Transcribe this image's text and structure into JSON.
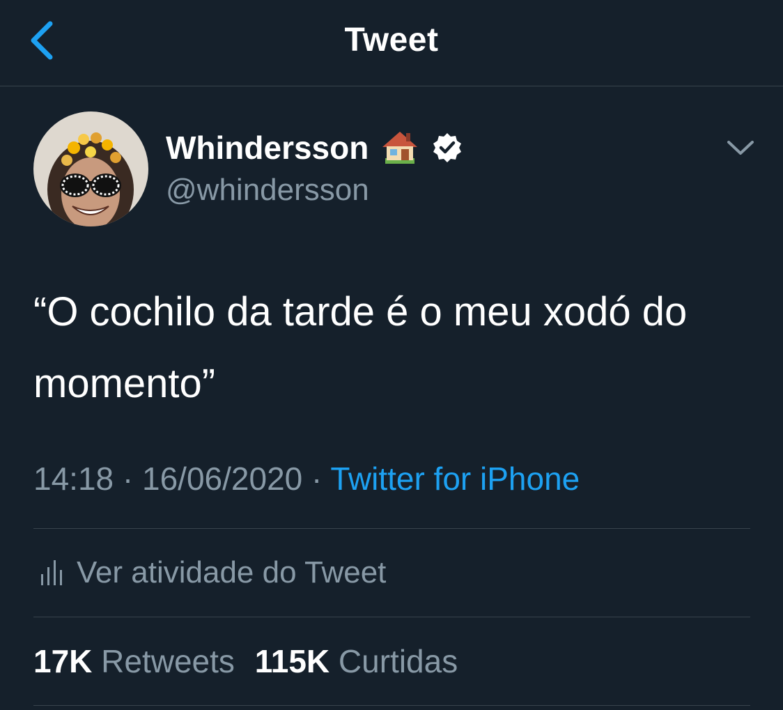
{
  "header": {
    "title": "Tweet",
    "back_icon": "chevron-left-icon"
  },
  "author": {
    "name": "Whindersson",
    "handle": "@whindersson",
    "name_emoji": "house-icon",
    "verified_icon": "verified-badge-icon"
  },
  "tweet": {
    "text": "“O cochilo da tarde é o meu xodó do momento”",
    "time": "14:18",
    "separator": "·",
    "date": "16/06/2020",
    "source": "Twitter for iPhone"
  },
  "activity": {
    "label": "Ver atividade do Tweet",
    "icon": "bar-chart-icon"
  },
  "stats": {
    "retweets_count": "17K",
    "retweets_label": "Retweets",
    "likes_count": "115K",
    "likes_label": "Curtidas"
  },
  "colors": {
    "background": "#15202b",
    "text_primary": "#ffffff",
    "text_secondary": "#8899a6",
    "accent": "#1da1f2",
    "divider": "#38444d"
  }
}
